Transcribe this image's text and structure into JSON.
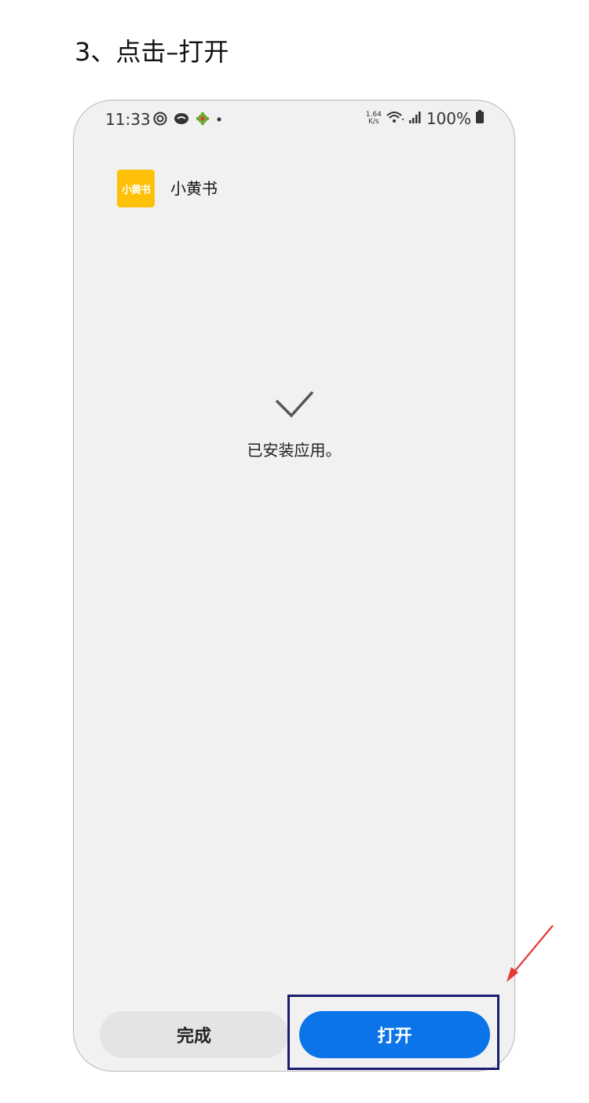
{
  "step_title": "3、点击–打开",
  "status_bar": {
    "time": "11:33",
    "left_icons": [
      "notification-swirl-icon",
      "chat-bubble-icon",
      "android-icon",
      "dot-icon"
    ],
    "net_speed_value": "1.64",
    "net_speed_unit": "K/s",
    "right_icons": [
      "wifi-icon",
      "signal-icon",
      "battery-icon"
    ],
    "battery_percent": "100%"
  },
  "app": {
    "icon_text": "小黄书",
    "name": "小黄书",
    "icon_color": "#FFC107"
  },
  "install_status": {
    "icon": "checkmark-icon",
    "message": "已安装应用。"
  },
  "buttons": {
    "done_label": "完成",
    "open_label": "打开"
  },
  "colors": {
    "primary": "#0A74E8",
    "secondary_button": "#E4E4E4",
    "background": "#F1F1F1",
    "highlight_box": "#1B1E6E",
    "annotation_arrow": "#E53935"
  }
}
